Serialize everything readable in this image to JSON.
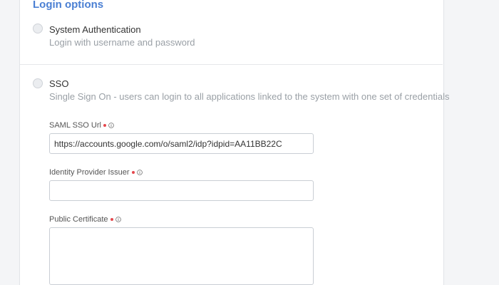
{
  "section": {
    "title": "Login options"
  },
  "options": [
    {
      "label": "System Authentication",
      "description": "Login with username and password",
      "selected": false
    },
    {
      "label": "SSO",
      "description": "Single Sign On - users can login to all applications linked to the system with one set of credentials",
      "selected": true
    }
  ],
  "fields": {
    "saml_sso_url": {
      "label": "SAML SSO Url",
      "value": "https://accounts.google.com/o/saml2/idp?idpid=AA11BB22C",
      "required": true
    },
    "identity_provider_issuer": {
      "label": "Identity Provider Issuer",
      "value": "",
      "required": true
    },
    "public_certificate": {
      "label": "Public Certificate",
      "value": "",
      "required": true
    }
  },
  "colors": {
    "accent": "#4a7fd3",
    "required_dot": "#e5484d"
  }
}
